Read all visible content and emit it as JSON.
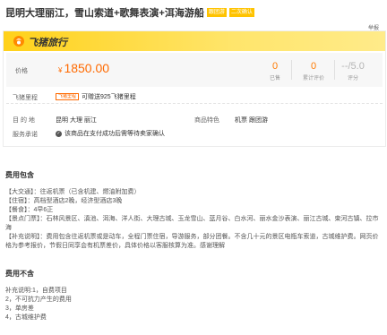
{
  "header": {
    "title": "昆明大理丽江，雪山索道+歌舞表演+洱海游船",
    "tags": [
      "跟团游",
      "二次确认"
    ],
    "report_label": "举报"
  },
  "brand": {
    "name": "飞猪旅行",
    "logo_icon": "fliggy-logo-icon"
  },
  "price": {
    "label": "价格",
    "currency": "¥",
    "value": "1850.00",
    "stats": [
      {
        "num": "0",
        "label": "已售"
      },
      {
        "num": "0",
        "label": "累计评价"
      },
      {
        "num": "--/5.0",
        "label": "评分"
      }
    ]
  },
  "mileage": {
    "label": "飞猪里程",
    "tag": "飞猪里程",
    "text": "可赠送925飞猪里程"
  },
  "destination": {
    "label": "目 的 地",
    "value": "昆明 大理 丽江"
  },
  "features": {
    "label": "商品特色",
    "value": "机票 跟团游"
  },
  "service": {
    "label": "服务承诺",
    "text": "该商品在支付成功后需等待卖家确认"
  },
  "fee_included": {
    "title": "费用包含",
    "lines": [
      "【大交通】：往返机票（已含机建、燃油附加费）",
      "【住宿】：高档型酒店2晚，经济型酒店3晚",
      "【餐食】：4早6正",
      "【景点门票】：石林风景区、滇池、洱海、洋人街、大理古城、玉龙雪山、蓝月谷、白水河、丽水金沙表演、丽江古城、束河古镇、拉市海",
      "【补充说明】：费用包含往返机票或是动车，全程门票住宿，导游服务，部分团餐。不含几十元的景区电瓶车索道，古城维护费。网页价格为参考报价，节假日同享会有机票差价，具体价格以客服核算为准。感谢理解"
    ]
  },
  "fee_excluded": {
    "title": "费用不含",
    "lines": [
      "补充说明:1，自费项目",
      "2，不可抗力产生的费用",
      "3，单房差",
      "4，古城维护费"
    ]
  },
  "colors": {
    "accent": "#ff6a00",
    "brand_yellow": "#ffd11a",
    "tag_yellow": "#ffc300"
  }
}
